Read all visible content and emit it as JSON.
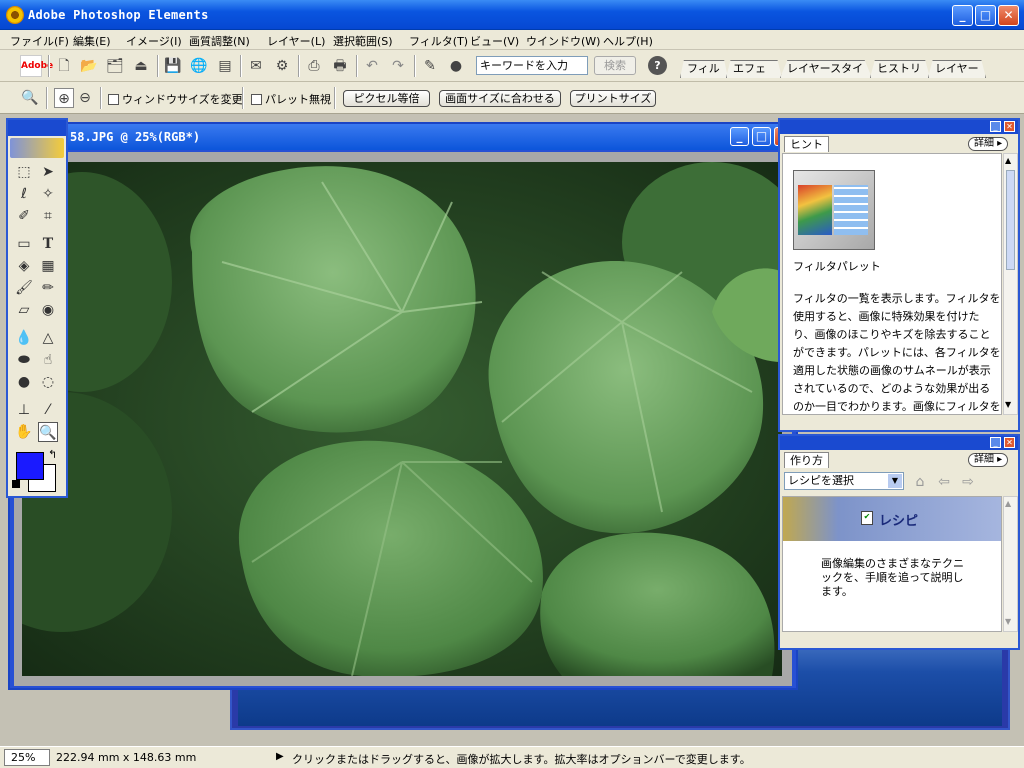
{
  "window": {
    "title": "Adobe Photoshop Elements",
    "controls": {
      "minimize": "_",
      "maximize": "□",
      "close": "✕"
    }
  },
  "menu": [
    "ファイル(F)",
    "編集(E)",
    "イメージ(I)",
    "画質調整(N)",
    "レイヤー(L)",
    "選択範囲(S)",
    "フィルタ(T)",
    "ビュー(V)",
    "ウインドウ(W)",
    "ヘルプ(H)"
  ],
  "toolbar": {
    "adobe_logo": "Adobe",
    "search_placeholder": "キーワードを入力",
    "search_button": "検索",
    "help_icon": "?",
    "palette_tabs": [
      "フィルタ",
      "エフェクト",
      "レイヤースタイル",
      "ヒストリー",
      "レイヤー"
    ]
  },
  "options_bar": {
    "resize_window": "ウィンドウサイズを変更",
    "ignore_palettes": "パレット無視",
    "actual_pixels": "ピクセル等倍",
    "fit_on_screen": "画面サイズに合わせる",
    "print_size": "プリントサイズ"
  },
  "document": {
    "title": "58.JPG @ 25%(RGB*)"
  },
  "hints_palette": {
    "tab": "ヒント",
    "details_button": "詳細",
    "item_title": "フィルタパレット",
    "body": "フィルタの一覧を表示します。フィルタを使用すると、画像に特殊効果を付けたり、画像のほこりやキズを除去することができます。パレットには、各フィルタを適用した状態の画像のサムネールが表示されているので、どのような効果が出るのか一目でわかります。画像にフィルタを適用するには、サム"
  },
  "howto_palette": {
    "tab": "作り方",
    "details_button": "詳細",
    "select_value": "レシピを選択",
    "banner_title": "レシピ",
    "body": "画像編集のさまざまなテクニックを、手順を追って説明します。"
  },
  "status": {
    "zoom": "25%",
    "dimensions": "222.94 mm x 148.63 mm",
    "message": "クリックまたはドラッグすると、画像が拡大します。拡大率はオプションバーで変更します。"
  },
  "colors": {
    "titlebar": "#0a55e0",
    "foreground_swatch": "#1a1aff",
    "background_swatch": "#ffffff",
    "leaf_green": "#4e8a48"
  },
  "icons": {
    "app": "sunflower-icon",
    "tools": [
      "marquee-icon",
      "move-icon",
      "lasso-icon",
      "magic-wand-icon",
      "selection-brush-icon",
      "crop-icon",
      "shape-icon",
      "type-icon",
      "paint-bucket-icon",
      "gradient-icon",
      "brush-icon",
      "pencil-icon",
      "eraser-icon",
      "red-eye-brush-icon",
      "blur-icon",
      "sharpen-icon",
      "sponge-icon",
      "smudge-icon",
      "burn-icon",
      "dodge-icon",
      "clone-stamp-icon",
      "eyedropper-icon",
      "hand-icon",
      "zoom-icon"
    ]
  }
}
